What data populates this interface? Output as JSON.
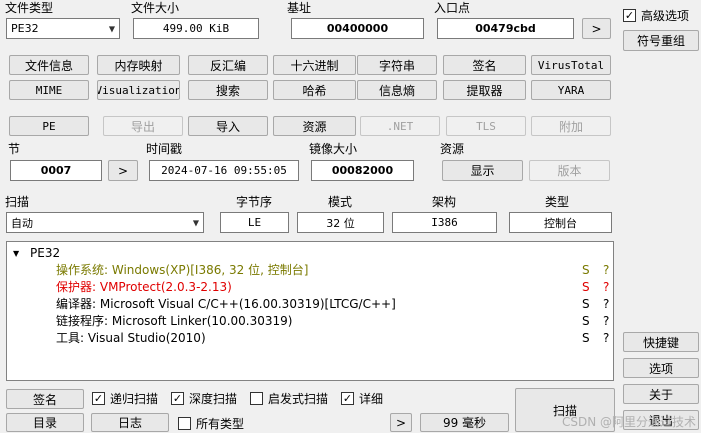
{
  "top": {
    "file_type_label": "文件类型",
    "file_type_value": "PE32",
    "file_size_label": "文件大小",
    "file_size_value": "499.00 KiB",
    "base_label": "基址",
    "base_value": "00400000",
    "entry_label": "入口点",
    "entry_value": "00479cbd",
    "entry_next": ">"
  },
  "right_panel": {
    "advanced_label": "高级选项",
    "advanced_checked": "✓",
    "symbol_button": "符号重组",
    "shortcuts_button": "快捷键",
    "options_button": "选项",
    "about_button": "关于",
    "exit_button": "退出"
  },
  "tool_rows": {
    "row1": [
      "文件信息",
      "内存映射",
      "反汇编",
      "十六进制",
      "字符串",
      "签名",
      "VirusTotal"
    ],
    "row2": [
      "MIME",
      "Visualization",
      "搜索",
      "哈希",
      "信息熵",
      "提取器",
      "YARA"
    ],
    "row3": [
      "PE",
      "导出",
      "导入",
      "资源",
      ".NET",
      "TLS",
      "附加"
    ]
  },
  "section": {
    "sections_label": "节",
    "sections_value": "0007",
    "sections_next": ">",
    "time_label": "时间戳",
    "time_value": "2024-07-16 09:55:05",
    "image_size_label": "镜像大小",
    "image_size_value": "00082000",
    "resources_label": "资源",
    "show_button": "显示",
    "version_button": "版本"
  },
  "scan": {
    "scan_label": "扫描",
    "scan_value": "自动",
    "endian_label": "字节序",
    "endian_value": "LE",
    "mode_label": "模式",
    "mode_value": "32 位",
    "arch_label": "架构",
    "arch_value": "I386",
    "type_label": "类型",
    "type_value": "控制台"
  },
  "results": {
    "root": "PE32",
    "root_arrow": "▼",
    "rows": [
      {
        "text": "操作系统: Windows(XP)[I386, 32 位, 控制台]",
        "s": "S",
        "q": "?",
        "color": "#7a7a00"
      },
      {
        "text": "保护器: VMProtect(2.0.3-2.13)",
        "s": "S",
        "q": "?",
        "color": "#e00000"
      },
      {
        "text": "编译器: Microsoft Visual C/C++(16.00.30319)[LTCG/C++]",
        "s": "S",
        "q": "?",
        "color": "#000000"
      },
      {
        "text": "链接程序: Microsoft Linker(10.00.30319)",
        "s": "S",
        "q": "?",
        "color": "#000000"
      },
      {
        "text": "工具: Visual Studio(2010)",
        "s": "S",
        "q": "?",
        "color": "#000000"
      }
    ]
  },
  "bottom": {
    "signature_button": "签名",
    "recursive_label": "递归扫描",
    "deep_label": "深度扫描",
    "heuristic_label": "启发式扫描",
    "verbose_label": "详细",
    "directory_button": "目录",
    "log_button": "日志",
    "all_types_label": "所有类型",
    "check_mark": "✓",
    "next_button": ">",
    "time_button": "99 毫秒",
    "scan_button": "扫描"
  },
  "watermark": "CSDN @阿里分通过技术"
}
